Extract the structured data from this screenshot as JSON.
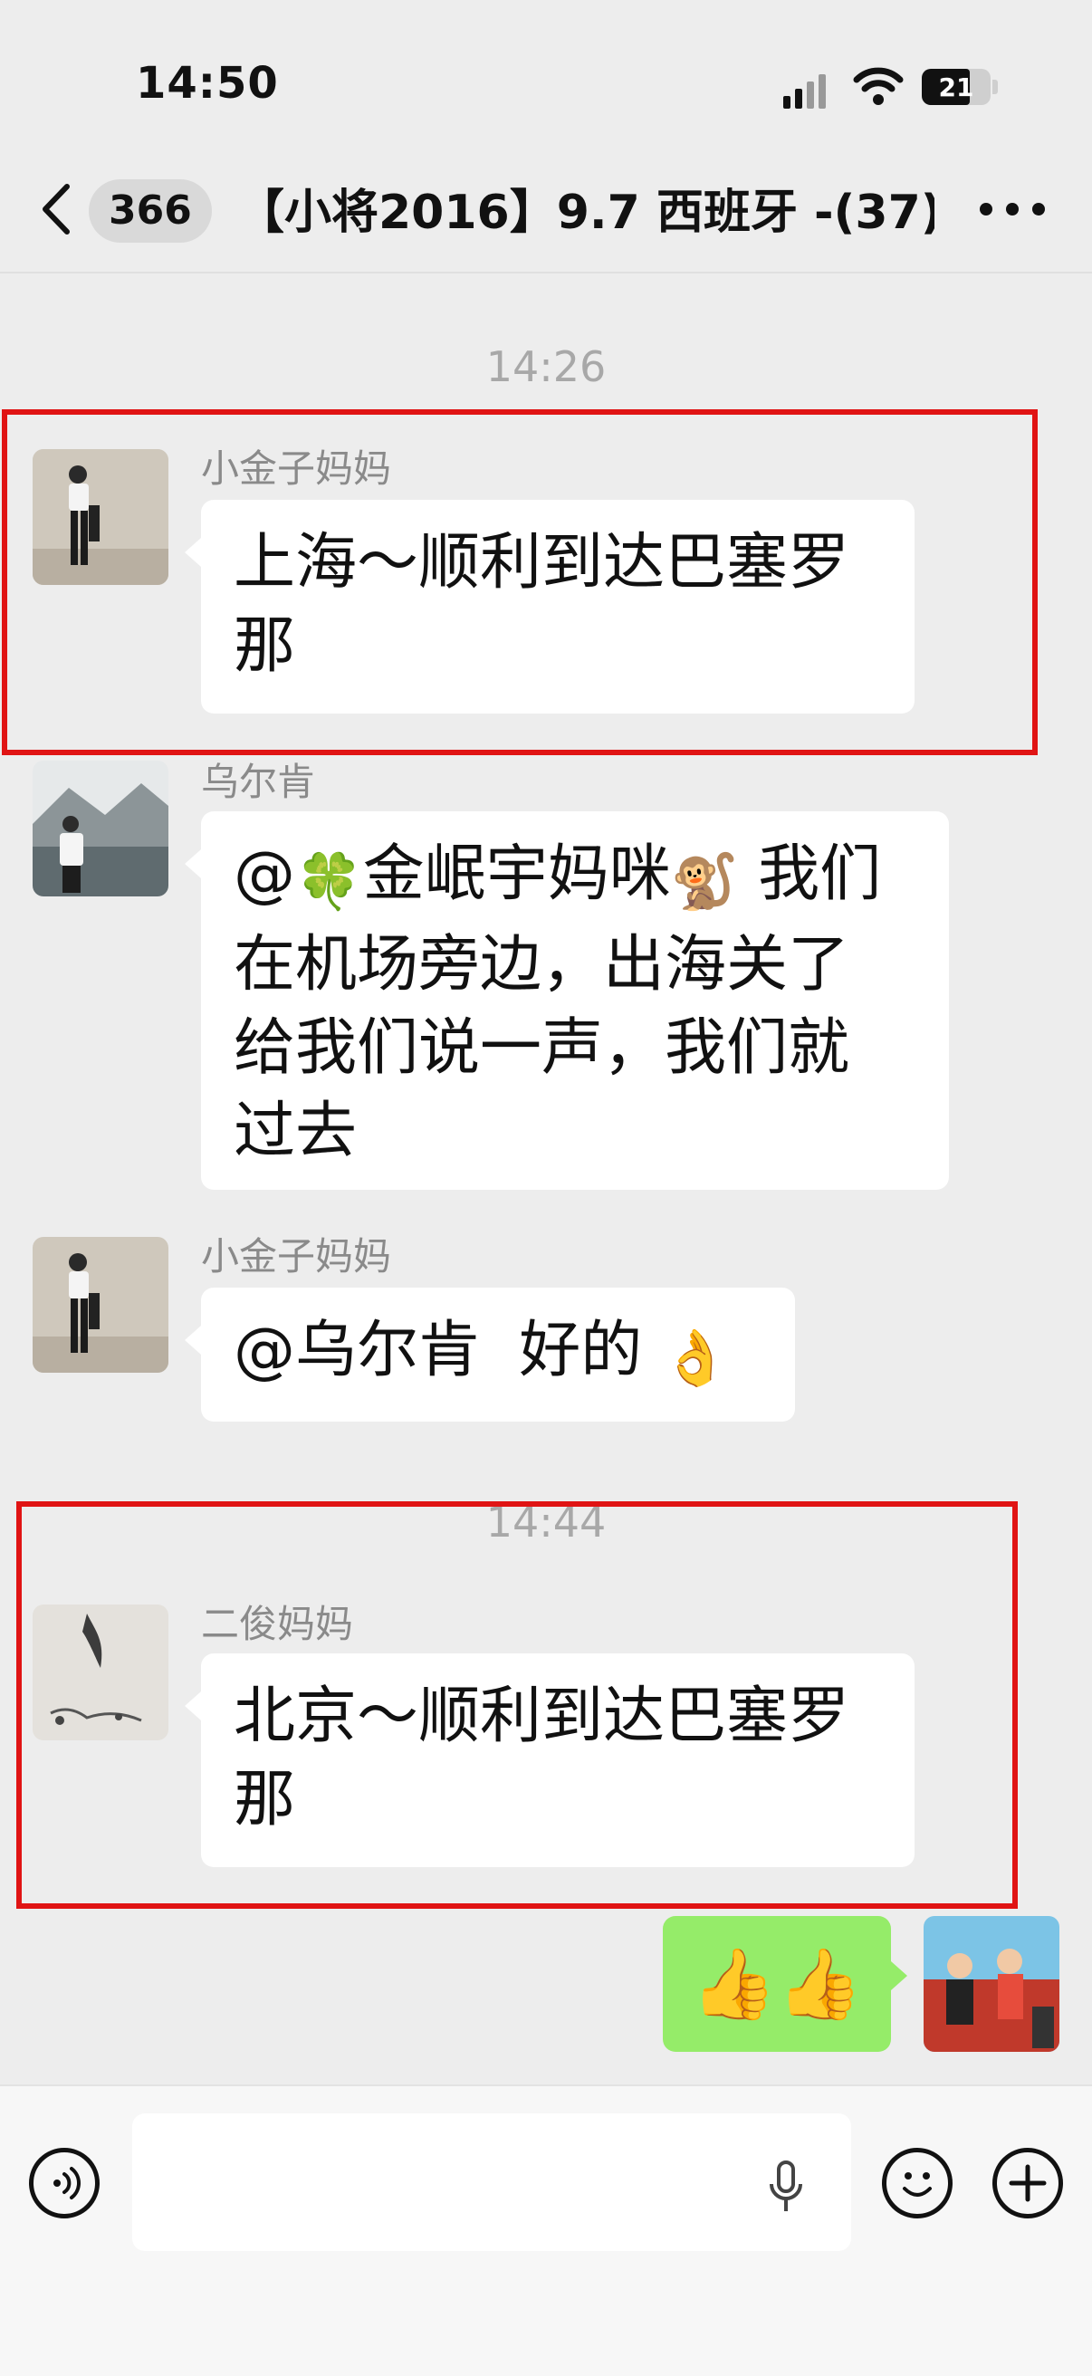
{
  "status_bar": {
    "time": "14:50",
    "battery_level": "21"
  },
  "nav": {
    "unread_count": "366",
    "title": "【小将2016】9.7 西班牙 -(37)"
  },
  "timestamps": [
    "14:26",
    "14:44"
  ],
  "messages": [
    {
      "sender": "小金子妈妈",
      "line1": "上海～顺利到达巴塞罗",
      "line2": "那"
    },
    {
      "sender": "乌尔肯",
      "line1_pre": "@",
      "line1_emoji1": "🍀",
      "line1_mid": "金岷宇妈咪",
      "line1_emoji2": "🐒",
      "line1_post": " 我们",
      "line2": "在机场旁边，出海关了",
      "line3": "给我们说一声，我们就",
      "line4": "过去"
    },
    {
      "sender": "小金子妈妈",
      "text": "@乌尔肯  好的 ",
      "emoji": "👌"
    },
    {
      "sender": "二俊妈妈",
      "line1": "北京～顺利到达巴塞罗",
      "line2": "那"
    }
  ],
  "outgoing": {
    "emoji": "👍👍"
  },
  "colors": {
    "background": "#ededed",
    "outgoing_bubble": "#95ec69",
    "highlight": "#e01414"
  }
}
